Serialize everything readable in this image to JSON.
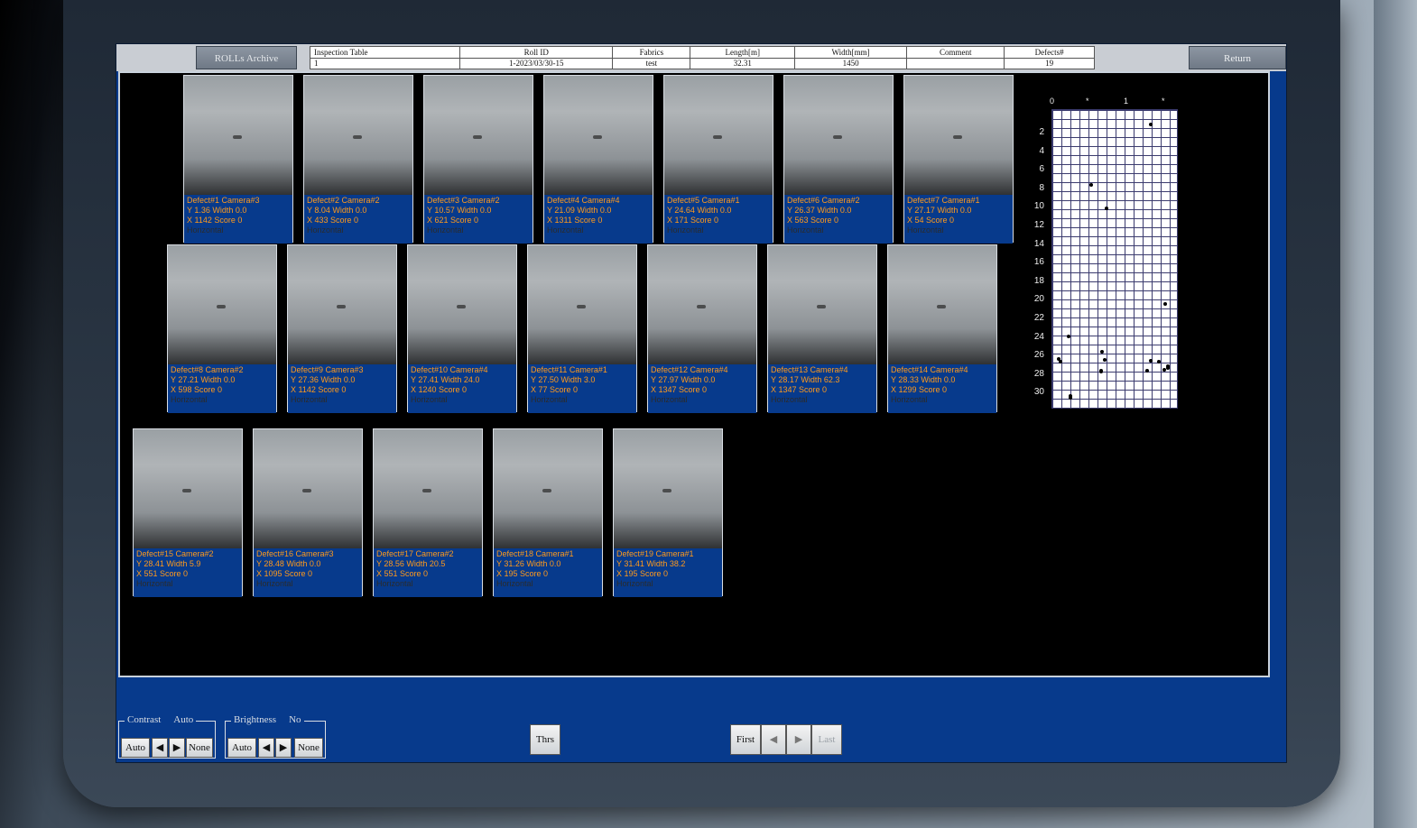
{
  "header": {
    "archive_label": "ROLLs Archive",
    "return_label": "Return",
    "columns": [
      "Inspection Table",
      "Roll ID",
      "Fabrics",
      "Length[m]",
      "Width[mm]",
      "Comment",
      "Defects#"
    ],
    "values": [
      "1",
      "1-2023/03/30-15",
      "test",
      "32.31",
      "1450",
      "",
      "19"
    ]
  },
  "defects": [
    {
      "title": "Defect#1  Camera#3",
      "line2": "Y 1.36  Width 0.0",
      "line3": "X 1142  Score 0",
      "dir": "Horizontal"
    },
    {
      "title": "Defect#2  Camera#2",
      "line2": "Y 8.04  Width 0.0",
      "line3": "X 433  Score 0",
      "dir": "Horizontal"
    },
    {
      "title": "Defect#3  Camera#2",
      "line2": "Y 10.57  Width 0.0",
      "line3": "X 621  Score 0",
      "dir": "Horizontal"
    },
    {
      "title": "Defect#4  Camera#4",
      "line2": "Y 21.09  Width 0.0",
      "line3": "X 1311  Score 0",
      "dir": "Horizontal"
    },
    {
      "title": "Defect#5  Camera#1",
      "line2": "Y 24.64  Width 0.0",
      "line3": "X 171  Score 0",
      "dir": "Horizontal"
    },
    {
      "title": "Defect#6  Camera#2",
      "line2": "Y 26.37  Width 0.0",
      "line3": "X 563  Score 0",
      "dir": "Horizontal"
    },
    {
      "title": "Defect#7  Camera#1",
      "line2": "Y 27.17  Width 0.0",
      "line3": "X  54  Score 0",
      "dir": "Horizontal"
    },
    {
      "title": "Defect#8  Camera#2",
      "line2": "Y 27.21  Width 0.0",
      "line3": "X 598  Score 0",
      "dir": "Horizontal"
    },
    {
      "title": "Defect#9  Camera#3",
      "line2": "Y 27.36  Width 0.0",
      "line3": "X 1142  Score 0",
      "dir": "Horizontal"
    },
    {
      "title": "Defect#10  Camera#4",
      "line2": "Y 27.41  Width 24.0",
      "line3": "X 1240  Score 0",
      "dir": "Horizontal"
    },
    {
      "title": "Defect#11  Camera#1",
      "line2": "Y 27.50  Width 3.0",
      "line3": "X  77  Score 0",
      "dir": "Horizontal"
    },
    {
      "title": "Defect#12  Camera#4",
      "line2": "Y 27.97  Width 0.0",
      "line3": "X 1347  Score 0",
      "dir": "Horizontal"
    },
    {
      "title": "Defect#13  Camera#4",
      "line2": "Y 28.17  Width 62.3",
      "line3": "X 1347  Score 0",
      "dir": "Horizontal"
    },
    {
      "title": "Defect#14  Camera#4",
      "line2": "Y 28.33  Width 0.0",
      "line3": "X 1299  Score 0",
      "dir": "Horizontal"
    },
    {
      "title": "Defect#15  Camera#2",
      "line2": "Y 28.41  Width 5.9",
      "line3": "X  551  Score 0",
      "dir": "Horizontal"
    },
    {
      "title": "Defect#16  Camera#3",
      "line2": "Y 28.48  Width 0.0",
      "line3": "X 1095  Score 0",
      "dir": "Horizontal"
    },
    {
      "title": "Defect#17  Camera#2",
      "line2": "Y 28.56  Width 20.5",
      "line3": "X  551  Score 0",
      "dir": "Horizontal"
    },
    {
      "title": "Defect#18  Camera#1",
      "line2": "Y 31.26  Width 0.0",
      "line3": "X  195  Score 0",
      "dir": "Horizontal"
    },
    {
      "title": "Defect#19  Camera#1",
      "line2": "Y 31.41  Width 38.2",
      "line3": "X  195  Score 0",
      "dir": "Horizontal"
    }
  ],
  "map": {
    "x_labels": [
      "0",
      "*",
      "1",
      "*"
    ],
    "y_labels": [
      "2",
      "4",
      "6",
      "8",
      "10",
      "12",
      "14",
      "16",
      "18",
      "20",
      "22",
      "24",
      "26",
      "28",
      "30"
    ]
  },
  "controls": {
    "contrast": {
      "label": "Contrast",
      "mode": "Auto",
      "auto": "Auto",
      "none": "None"
    },
    "brightness": {
      "label": "Brightness",
      "mode": "No",
      "auto": "Auto",
      "none": "None"
    },
    "thrs": "Thrs",
    "first": "First",
    "last": "Last"
  },
  "colors": {
    "panel": "#073a8c",
    "caption_text": "#ff9a1c"
  }
}
